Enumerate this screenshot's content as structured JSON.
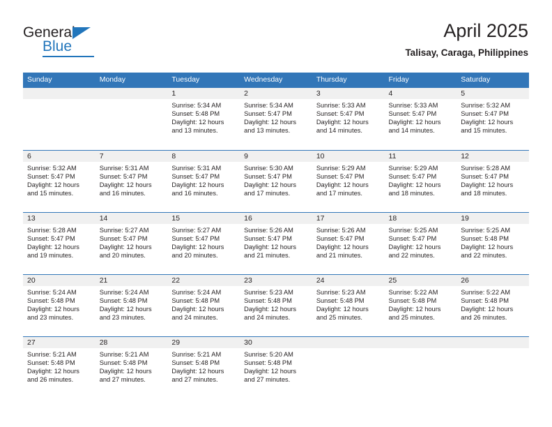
{
  "brand": {
    "name_part1": "General",
    "name_part2": "Blue",
    "triangle_icon": "triangle-icon",
    "accent_color": "#2175bb"
  },
  "header": {
    "title": "April 2025",
    "subtitle": "Talisay, Caraga, Philippines"
  },
  "theme": {
    "header_blue": "#3276b8",
    "daynum_band": "#f0f0f0",
    "text": "#231f20"
  },
  "weekdays": [
    "Sunday",
    "Monday",
    "Tuesday",
    "Wednesday",
    "Thursday",
    "Friday",
    "Saturday"
  ],
  "weeks": [
    [
      {
        "day": "",
        "sunrise": "",
        "sunset": "",
        "daylight_line1": "",
        "daylight_line2": ""
      },
      {
        "day": "",
        "sunrise": "",
        "sunset": "",
        "daylight_line1": "",
        "daylight_line2": ""
      },
      {
        "day": "1",
        "sunrise": "Sunrise: 5:34 AM",
        "sunset": "Sunset: 5:48 PM",
        "daylight_line1": "Daylight: 12 hours",
        "daylight_line2": "and 13 minutes."
      },
      {
        "day": "2",
        "sunrise": "Sunrise: 5:34 AM",
        "sunset": "Sunset: 5:47 PM",
        "daylight_line1": "Daylight: 12 hours",
        "daylight_line2": "and 13 minutes."
      },
      {
        "day": "3",
        "sunrise": "Sunrise: 5:33 AM",
        "sunset": "Sunset: 5:47 PM",
        "daylight_line1": "Daylight: 12 hours",
        "daylight_line2": "and 14 minutes."
      },
      {
        "day": "4",
        "sunrise": "Sunrise: 5:33 AM",
        "sunset": "Sunset: 5:47 PM",
        "daylight_line1": "Daylight: 12 hours",
        "daylight_line2": "and 14 minutes."
      },
      {
        "day": "5",
        "sunrise": "Sunrise: 5:32 AM",
        "sunset": "Sunset: 5:47 PM",
        "daylight_line1": "Daylight: 12 hours",
        "daylight_line2": "and 15 minutes."
      }
    ],
    [
      {
        "day": "6",
        "sunrise": "Sunrise: 5:32 AM",
        "sunset": "Sunset: 5:47 PM",
        "daylight_line1": "Daylight: 12 hours",
        "daylight_line2": "and 15 minutes."
      },
      {
        "day": "7",
        "sunrise": "Sunrise: 5:31 AM",
        "sunset": "Sunset: 5:47 PM",
        "daylight_line1": "Daylight: 12 hours",
        "daylight_line2": "and 16 minutes."
      },
      {
        "day": "8",
        "sunrise": "Sunrise: 5:31 AM",
        "sunset": "Sunset: 5:47 PM",
        "daylight_line1": "Daylight: 12 hours",
        "daylight_line2": "and 16 minutes."
      },
      {
        "day": "9",
        "sunrise": "Sunrise: 5:30 AM",
        "sunset": "Sunset: 5:47 PM",
        "daylight_line1": "Daylight: 12 hours",
        "daylight_line2": "and 17 minutes."
      },
      {
        "day": "10",
        "sunrise": "Sunrise: 5:29 AM",
        "sunset": "Sunset: 5:47 PM",
        "daylight_line1": "Daylight: 12 hours",
        "daylight_line2": "and 17 minutes."
      },
      {
        "day": "11",
        "sunrise": "Sunrise: 5:29 AM",
        "sunset": "Sunset: 5:47 PM",
        "daylight_line1": "Daylight: 12 hours",
        "daylight_line2": "and 18 minutes."
      },
      {
        "day": "12",
        "sunrise": "Sunrise: 5:28 AM",
        "sunset": "Sunset: 5:47 PM",
        "daylight_line1": "Daylight: 12 hours",
        "daylight_line2": "and 18 minutes."
      }
    ],
    [
      {
        "day": "13",
        "sunrise": "Sunrise: 5:28 AM",
        "sunset": "Sunset: 5:47 PM",
        "daylight_line1": "Daylight: 12 hours",
        "daylight_line2": "and 19 minutes."
      },
      {
        "day": "14",
        "sunrise": "Sunrise: 5:27 AM",
        "sunset": "Sunset: 5:47 PM",
        "daylight_line1": "Daylight: 12 hours",
        "daylight_line2": "and 20 minutes."
      },
      {
        "day": "15",
        "sunrise": "Sunrise: 5:27 AM",
        "sunset": "Sunset: 5:47 PM",
        "daylight_line1": "Daylight: 12 hours",
        "daylight_line2": "and 20 minutes."
      },
      {
        "day": "16",
        "sunrise": "Sunrise: 5:26 AM",
        "sunset": "Sunset: 5:47 PM",
        "daylight_line1": "Daylight: 12 hours",
        "daylight_line2": "and 21 minutes."
      },
      {
        "day": "17",
        "sunrise": "Sunrise: 5:26 AM",
        "sunset": "Sunset: 5:47 PM",
        "daylight_line1": "Daylight: 12 hours",
        "daylight_line2": "and 21 minutes."
      },
      {
        "day": "18",
        "sunrise": "Sunrise: 5:25 AM",
        "sunset": "Sunset: 5:47 PM",
        "daylight_line1": "Daylight: 12 hours",
        "daylight_line2": "and 22 minutes."
      },
      {
        "day": "19",
        "sunrise": "Sunrise: 5:25 AM",
        "sunset": "Sunset: 5:48 PM",
        "daylight_line1": "Daylight: 12 hours",
        "daylight_line2": "and 22 minutes."
      }
    ],
    [
      {
        "day": "20",
        "sunrise": "Sunrise: 5:24 AM",
        "sunset": "Sunset: 5:48 PM",
        "daylight_line1": "Daylight: 12 hours",
        "daylight_line2": "and 23 minutes."
      },
      {
        "day": "21",
        "sunrise": "Sunrise: 5:24 AM",
        "sunset": "Sunset: 5:48 PM",
        "daylight_line1": "Daylight: 12 hours",
        "daylight_line2": "and 23 minutes."
      },
      {
        "day": "22",
        "sunrise": "Sunrise: 5:24 AM",
        "sunset": "Sunset: 5:48 PM",
        "daylight_line1": "Daylight: 12 hours",
        "daylight_line2": "and 24 minutes."
      },
      {
        "day": "23",
        "sunrise": "Sunrise: 5:23 AM",
        "sunset": "Sunset: 5:48 PM",
        "daylight_line1": "Daylight: 12 hours",
        "daylight_line2": "and 24 minutes."
      },
      {
        "day": "24",
        "sunrise": "Sunrise: 5:23 AM",
        "sunset": "Sunset: 5:48 PM",
        "daylight_line1": "Daylight: 12 hours",
        "daylight_line2": "and 25 minutes."
      },
      {
        "day": "25",
        "sunrise": "Sunrise: 5:22 AM",
        "sunset": "Sunset: 5:48 PM",
        "daylight_line1": "Daylight: 12 hours",
        "daylight_line2": "and 25 minutes."
      },
      {
        "day": "26",
        "sunrise": "Sunrise: 5:22 AM",
        "sunset": "Sunset: 5:48 PM",
        "daylight_line1": "Daylight: 12 hours",
        "daylight_line2": "and 26 minutes."
      }
    ],
    [
      {
        "day": "27",
        "sunrise": "Sunrise: 5:21 AM",
        "sunset": "Sunset: 5:48 PM",
        "daylight_line1": "Daylight: 12 hours",
        "daylight_line2": "and 26 minutes."
      },
      {
        "day": "28",
        "sunrise": "Sunrise: 5:21 AM",
        "sunset": "Sunset: 5:48 PM",
        "daylight_line1": "Daylight: 12 hours",
        "daylight_line2": "and 27 minutes."
      },
      {
        "day": "29",
        "sunrise": "Sunrise: 5:21 AM",
        "sunset": "Sunset: 5:48 PM",
        "daylight_line1": "Daylight: 12 hours",
        "daylight_line2": "and 27 minutes."
      },
      {
        "day": "30",
        "sunrise": "Sunrise: 5:20 AM",
        "sunset": "Sunset: 5:48 PM",
        "daylight_line1": "Daylight: 12 hours",
        "daylight_line2": "and 27 minutes."
      },
      {
        "day": "",
        "sunrise": "",
        "sunset": "",
        "daylight_line1": "",
        "daylight_line2": ""
      },
      {
        "day": "",
        "sunrise": "",
        "sunset": "",
        "daylight_line1": "",
        "daylight_line2": ""
      },
      {
        "day": "",
        "sunrise": "",
        "sunset": "",
        "daylight_line1": "",
        "daylight_line2": ""
      }
    ]
  ]
}
